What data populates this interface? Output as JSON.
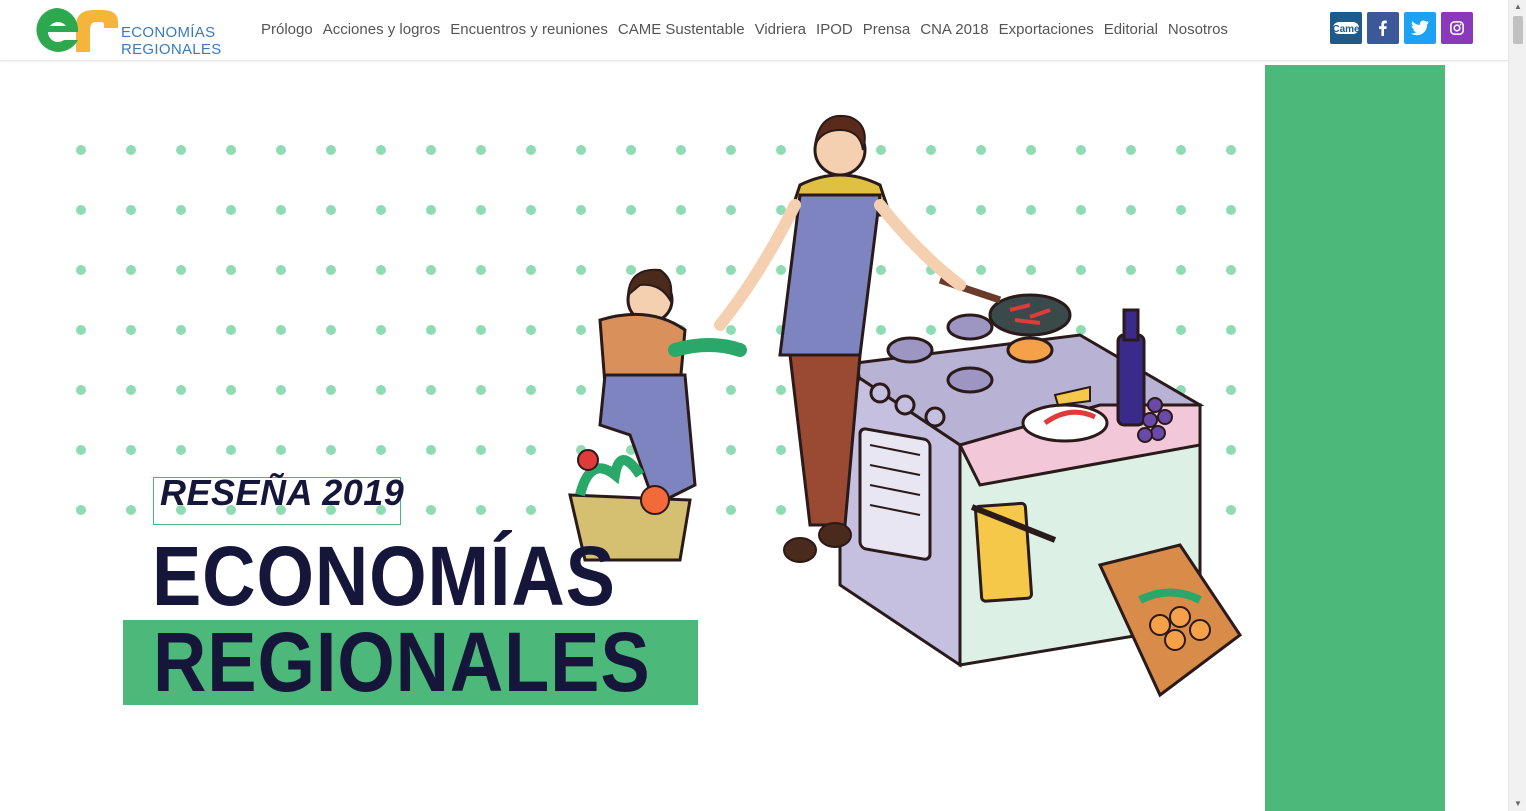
{
  "brand": {
    "logo_line1": "ECONOMÍAS",
    "logo_line2": "REGIONALES",
    "colors": {
      "green": "#4cb879",
      "orange": "#f5b43c",
      "blue": "#3a7bbf",
      "navy": "#16163a"
    }
  },
  "nav": {
    "items": [
      {
        "label": "Prólogo"
      },
      {
        "label": "Acciones y logros"
      },
      {
        "label": "Encuentros y reuniones"
      },
      {
        "label": "CAME Sustentable"
      },
      {
        "label": "Vidriera"
      },
      {
        "label": "IPOD"
      },
      {
        "label": "Prensa"
      },
      {
        "label": "CNA 2018"
      },
      {
        "label": "Exportaciones"
      },
      {
        "label": "Editorial"
      },
      {
        "label": "Nosotros"
      }
    ]
  },
  "social": {
    "came_label": "Came",
    "items": [
      {
        "icon": "came-icon",
        "color": "#1e5a8a"
      },
      {
        "icon": "facebook-icon",
        "color": "#3b5998"
      },
      {
        "icon": "twitter-icon",
        "color": "#1da1f2"
      },
      {
        "icon": "instagram-icon",
        "color": "#8a3ab9"
      }
    ]
  },
  "hero": {
    "kicker": "RESEÑA 2019",
    "title_line1": "ECONOMÍAS",
    "title_line2": "REGIONALES",
    "illustration": "family-cooking-illustration"
  }
}
